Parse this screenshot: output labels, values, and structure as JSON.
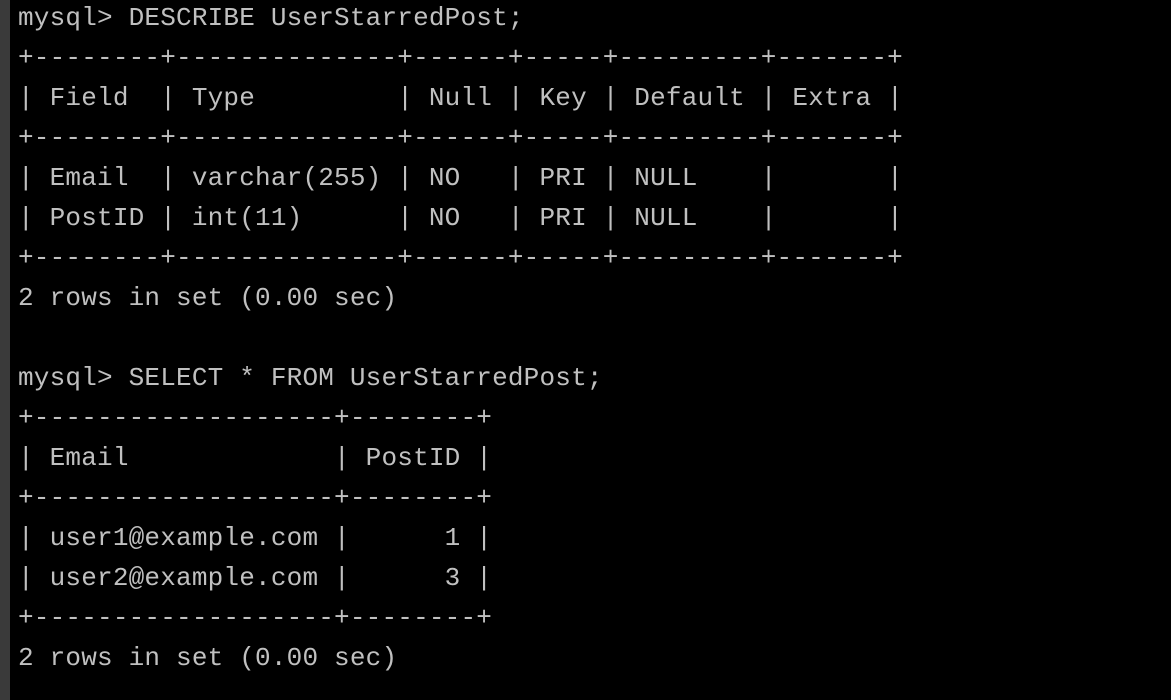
{
  "terminal": {
    "lines": [
      {
        "name": "prompt-describe",
        "text": "mysql> DESCRIBE UserStarredPost;"
      },
      {
        "name": "describe-border-top",
        "text": "+--------+--------------+------+-----+---------+-------+"
      },
      {
        "name": "describe-header-row",
        "text": "| Field  | Type         | Null | Key | Default | Extra |"
      },
      {
        "name": "describe-border-mid",
        "text": "+--------+--------------+------+-----+---------+-------+"
      },
      {
        "name": "describe-row-email",
        "text": "| Email  | varchar(255) | NO   | PRI | NULL    |       |"
      },
      {
        "name": "describe-row-postid",
        "text": "| PostID | int(11)      | NO   | PRI | NULL    |       |"
      },
      {
        "name": "describe-border-bottom",
        "text": "+--------+--------------+------+-----+---------+-------+"
      },
      {
        "name": "describe-row-count",
        "text": "2 rows in set (0.00 sec)"
      },
      {
        "name": "blank-line",
        "text": ""
      },
      {
        "name": "prompt-select",
        "text": "mysql> SELECT * FROM UserStarredPost;"
      },
      {
        "name": "select-border-top",
        "text": "+-------------------+--------+"
      },
      {
        "name": "select-header-row",
        "text": "| Email             | PostID |"
      },
      {
        "name": "select-border-mid",
        "text": "+-------------------+--------+"
      },
      {
        "name": "select-row-1",
        "text": "| user1@example.com |      1 |"
      },
      {
        "name": "select-row-2",
        "text": "| user2@example.com |      3 |"
      },
      {
        "name": "select-border-bottom",
        "text": "+-------------------+--------+"
      },
      {
        "name": "select-row-count",
        "text": "2 rows in set (0.00 sec)"
      }
    ]
  },
  "colors": {
    "background": "#000000",
    "foreground": "#c0c0c0",
    "window_border": "#3a3a3a"
  }
}
